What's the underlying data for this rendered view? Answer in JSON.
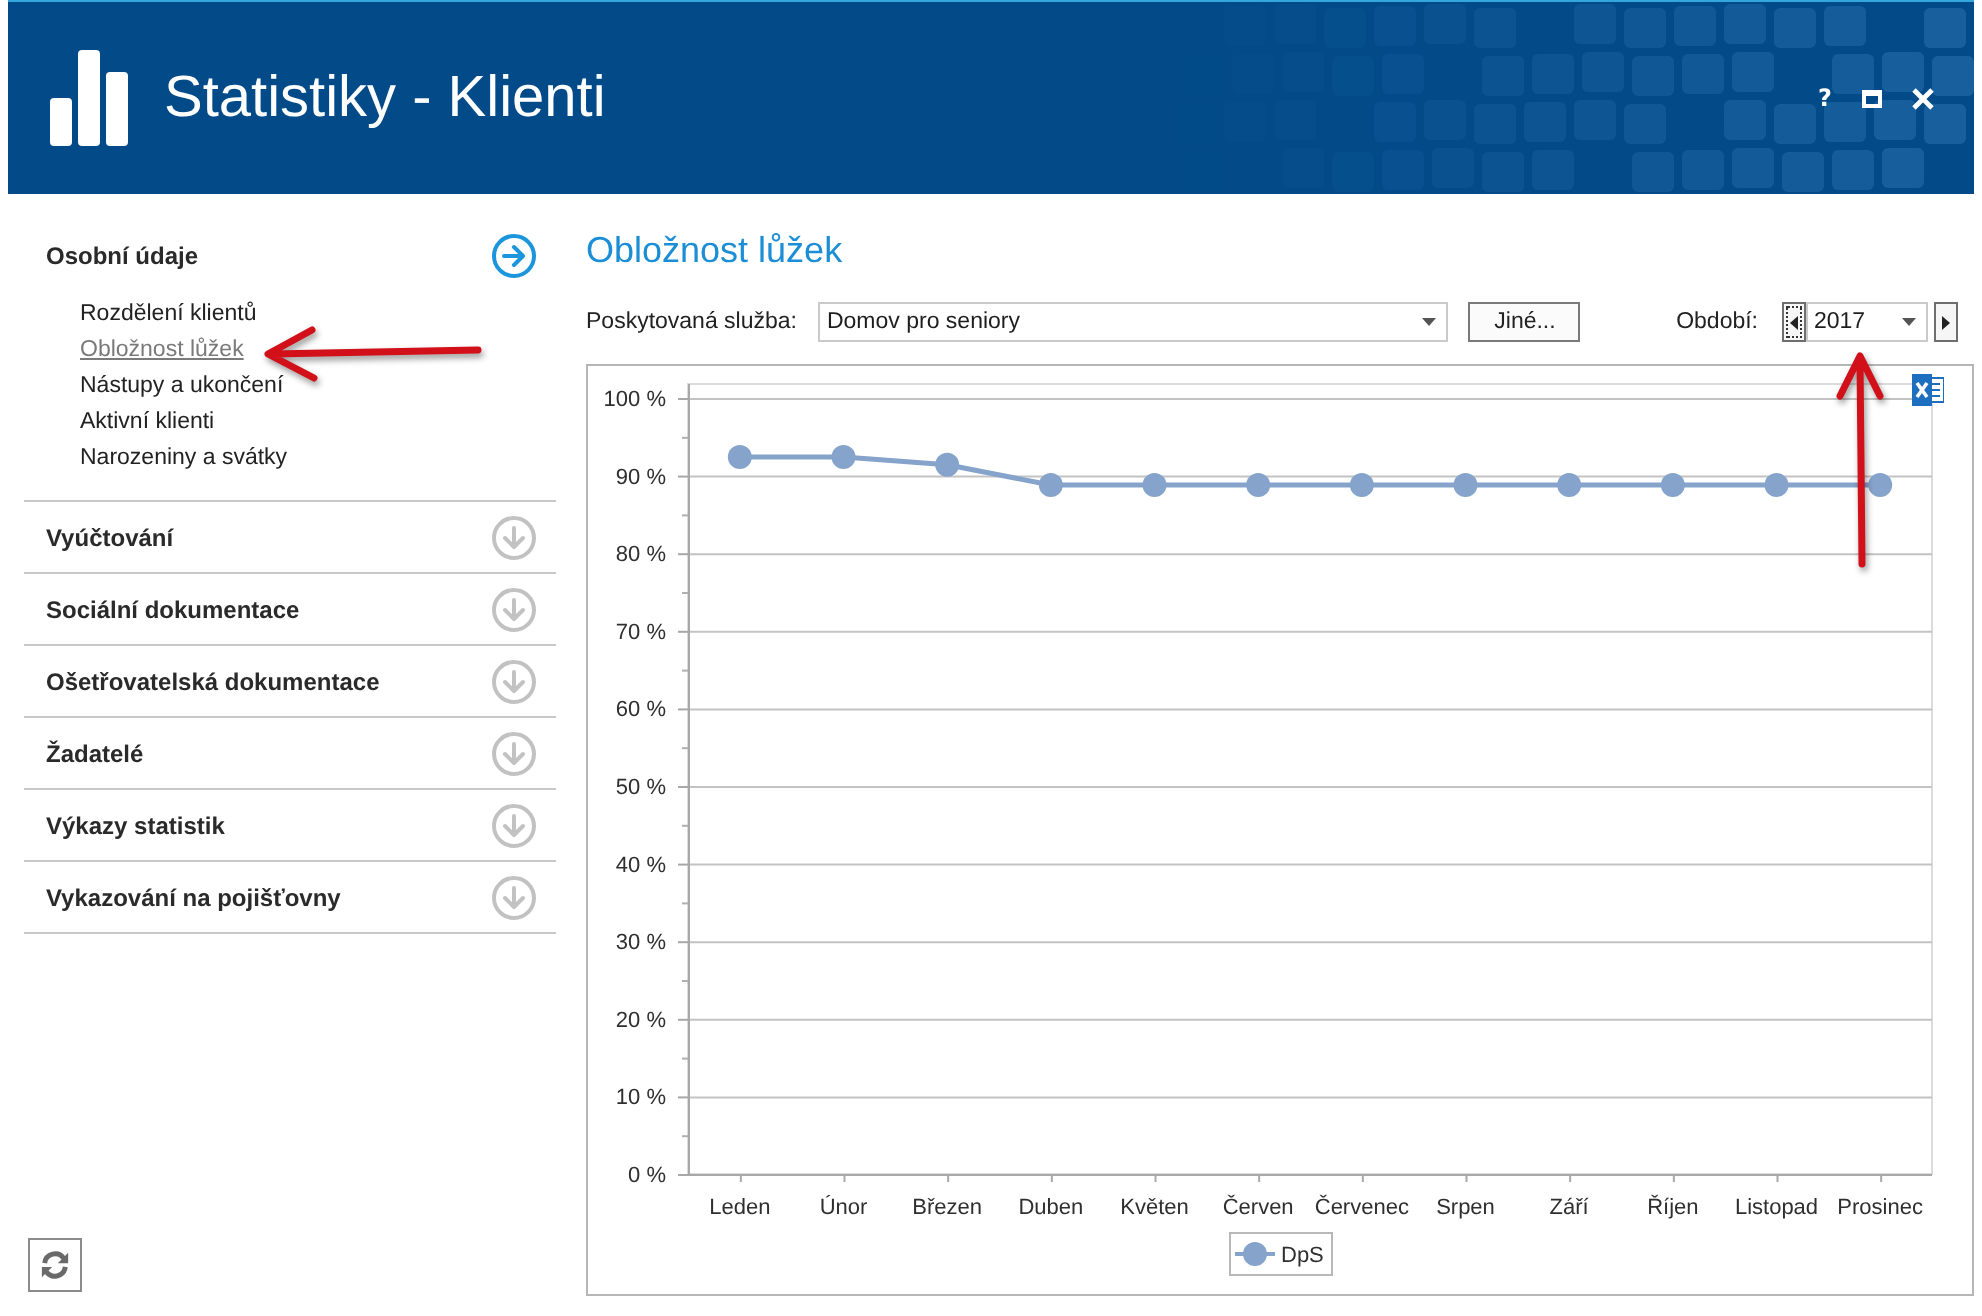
{
  "window": {
    "title": "Statistiky - Klienti",
    "help": "?"
  },
  "sidebar": {
    "sections": [
      {
        "title": "Osobní údaje",
        "expanded": true,
        "items": [
          {
            "label": "Rozdělení klientů",
            "selected": false
          },
          {
            "label": "Obložnost lůžek",
            "selected": true
          },
          {
            "label": "Nástupy a ukončení",
            "selected": false
          },
          {
            "label": "Aktivní klienti",
            "selected": false
          },
          {
            "label": "Narozeniny a svátky",
            "selected": false
          }
        ]
      },
      {
        "title": "Vyúčtování",
        "expanded": false
      },
      {
        "title": "Sociální dokumentace",
        "expanded": false
      },
      {
        "title": "Ošetřovatelská dokumentace",
        "expanded": false
      },
      {
        "title": "Žadatelé",
        "expanded": false
      },
      {
        "title": "Výkazy statistik",
        "expanded": false
      },
      {
        "title": "Vykazování na pojišťovny",
        "expanded": false
      }
    ]
  },
  "main": {
    "title": "Obložnost lůžek",
    "service": {
      "label": "Poskytovaná služba:",
      "value": "Domov pro seniory"
    },
    "other_button": "Jiné...",
    "period": {
      "label": "Období:",
      "value": "2017"
    },
    "chart_data": {
      "type": "line",
      "grid": true,
      "categories": [
        "Leden",
        "Únor",
        "Březen",
        "Duben",
        "Květen",
        "Červen",
        "Červenec",
        "Srpen",
        "Září",
        "Říjen",
        "Listopad",
        "Prosinec"
      ],
      "series": [
        {
          "name": "DpS",
          "color": "#86a3cb",
          "marker": "circle",
          "values": [
            92.4,
            92.4,
            91.4,
            88.8,
            88.8,
            88.8,
            88.8,
            88.8,
            88.8,
            88.8,
            88.8,
            88.8
          ]
        }
      ],
      "ylim": [
        0,
        100
      ],
      "yticks": [
        {
          "value": 0,
          "label": "0 %"
        },
        {
          "value": 10,
          "label": "10 %"
        },
        {
          "value": 20,
          "label": "20 %"
        },
        {
          "value": 30,
          "label": "30 %"
        },
        {
          "value": 40,
          "label": "40 %"
        },
        {
          "value": 50,
          "label": "50 %"
        },
        {
          "value": 60,
          "label": "60 %"
        },
        {
          "value": 70,
          "label": "70 %"
        },
        {
          "value": 80,
          "label": "80 %"
        },
        {
          "value": 90,
          "label": "90 %"
        },
        {
          "value": 100,
          "label": "100 %"
        }
      ]
    }
  }
}
